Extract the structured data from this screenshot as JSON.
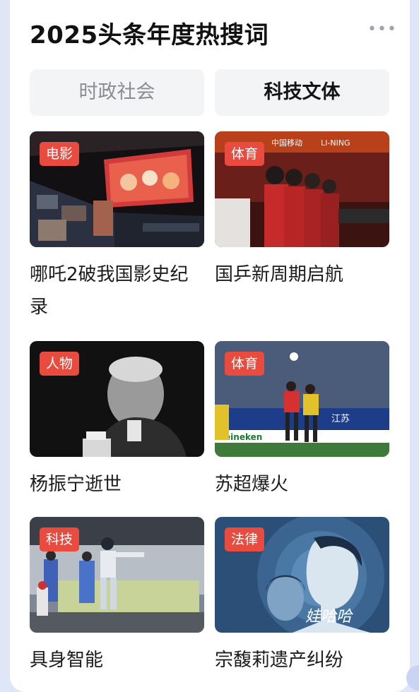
{
  "header": {
    "title": "2025头条年度热搜词",
    "more_icon": "more-dots-icon"
  },
  "tabs": [
    {
      "label": "时政社会",
      "selected": false
    },
    {
      "label": "科技文体",
      "selected": true
    }
  ],
  "items": [
    {
      "tag": "电影",
      "caption": "哪吒2破我国影史纪录"
    },
    {
      "tag": "体育",
      "caption": "国乒新周期启航"
    },
    {
      "tag": "人物",
      "caption": "杨振宁逝世"
    },
    {
      "tag": "体育",
      "caption": "苏超爆火"
    },
    {
      "tag": "科技",
      "caption": "具身智能"
    },
    {
      "tag": "法律",
      "caption": "宗馥莉遗产纠纷"
    }
  ],
  "image_text": {
    "sponsor_1": "中国移动",
    "sponsor_2": "LI-NING",
    "ad_1": "Heineken",
    "ad_2": "江苏",
    "artwork_text": "娃哈哈"
  },
  "colors": {
    "tag_bg": "#ea4b3f",
    "page_bg": "#dfe6f7"
  }
}
